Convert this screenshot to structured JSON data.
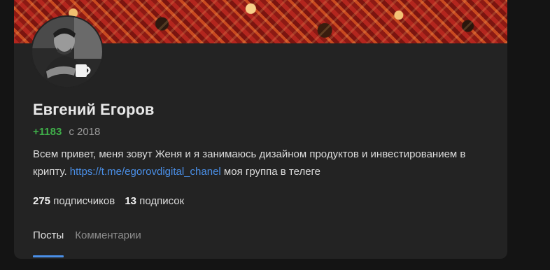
{
  "profile": {
    "name": "Евгений Егоров",
    "rating": "+1183",
    "since": "с 2018",
    "bio_text": "Всем привет, меня зовут Женя и я занимаюсь дизайном продуктов и инвестированием в крипту. ",
    "bio_link": "https://t.me/egorovdigital_chanel",
    "bio_suffix": " моя группа в телеге"
  },
  "stats": {
    "subscribers_count": "275",
    "subscribers_label": "подписчиков",
    "subscriptions_count": "13",
    "subscriptions_label": "подписок"
  },
  "tabs": [
    {
      "label": "Посты",
      "active": true
    },
    {
      "label": "Комментарии",
      "active": false
    }
  ],
  "colors": {
    "accent": "#4a8fe7",
    "rating": "#3fae49",
    "card": "#232323"
  }
}
